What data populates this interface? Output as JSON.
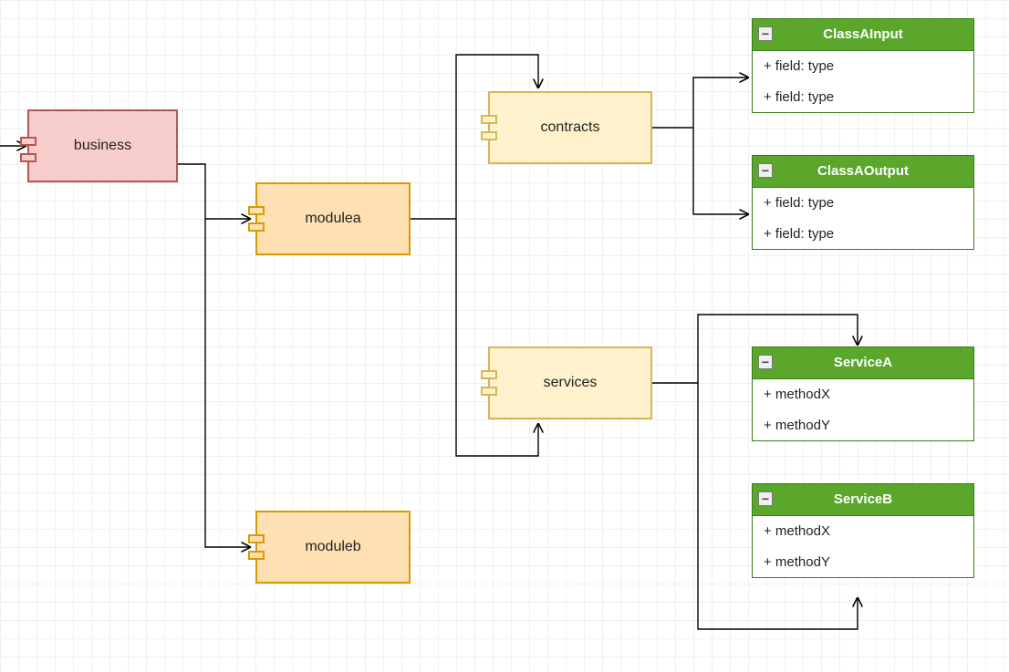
{
  "components": {
    "business": "business",
    "modulea": "modulea",
    "moduleb": "moduleb",
    "contracts": "contracts",
    "services": "services"
  },
  "classes": {
    "classAInput": {
      "title": "ClassAInput",
      "members": [
        "+ field: type",
        "+ field: type"
      ]
    },
    "classAOutput": {
      "title": "ClassAOutput",
      "members": [
        "+ field: type",
        "+ field: type"
      ]
    },
    "serviceA": {
      "title": "ServiceA",
      "members": [
        "+ methodX",
        "+ methodY"
      ]
    },
    "serviceB": {
      "title": "ServiceB",
      "members": [
        "+ methodX",
        "+ methodY"
      ]
    }
  },
  "collapseGlyph": "−"
}
